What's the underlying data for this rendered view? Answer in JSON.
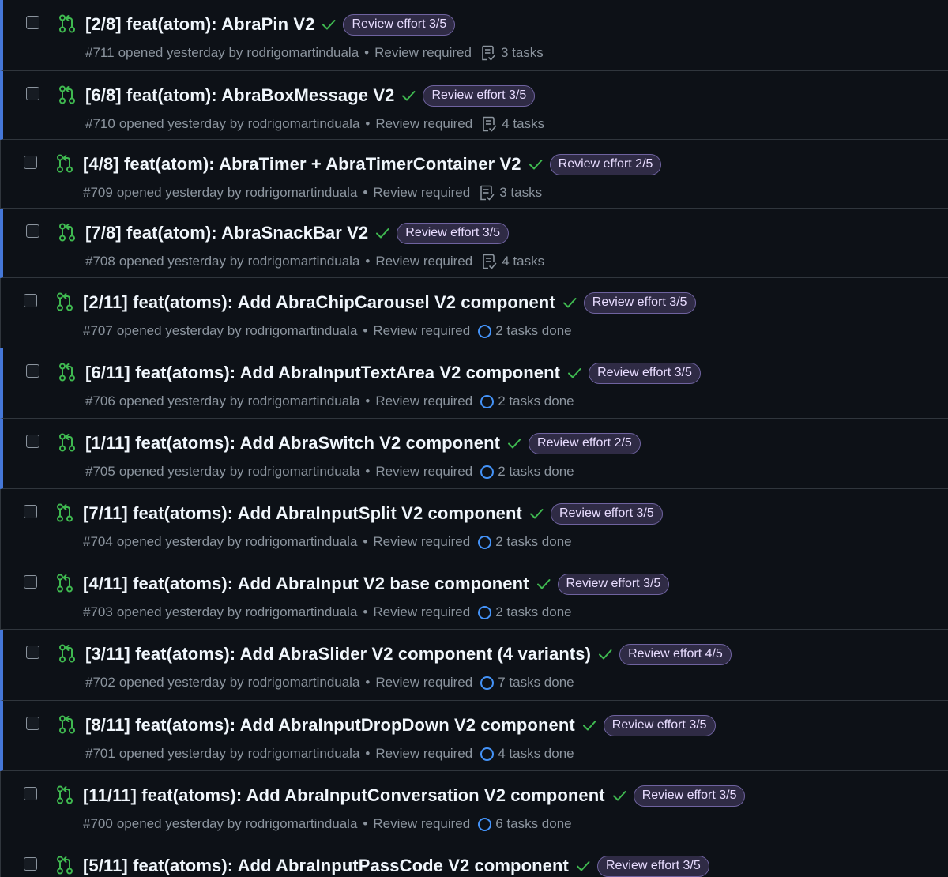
{
  "colors": {
    "background": "#0d1117",
    "border": "#30363d",
    "unread_accent": "#4577d8",
    "open_pr_icon": "#3fb950",
    "check_success": "#3fb950",
    "label_text": "#e8dcff",
    "label_bg": "#2f2b45",
    "muted_text": "#8b949e",
    "progress_ring": "#4493f8"
  },
  "meta": {
    "opened_text": "opened yesterday by",
    "separator": "•"
  },
  "pull_requests": [
    {
      "number": "#711",
      "title": "[2/8] feat(atom): AbraPin V2",
      "label": "Review effort 3/5",
      "author": "rodrigomartinduala",
      "review": "Review required",
      "tasks": "3 tasks",
      "task_style": "list",
      "unread": true
    },
    {
      "number": "#710",
      "title": "[6/8] feat(atom): AbraBoxMessage V2",
      "label": "Review effort 3/5",
      "author": "rodrigomartinduala",
      "review": "Review required",
      "tasks": "4 tasks",
      "task_style": "list",
      "unread": true
    },
    {
      "number": "#709",
      "title": "[4/8] feat(atom): AbraTimer + AbraTimerContainer V2",
      "label": "Review effort 2/5",
      "author": "rodrigomartinduala",
      "review": "Review required",
      "tasks": "3 tasks",
      "task_style": "list",
      "unread": false
    },
    {
      "number": "#708",
      "title": "[7/8] feat(atom): AbraSnackBar V2",
      "label": "Review effort 3/5",
      "author": "rodrigomartinduala",
      "review": "Review required",
      "tasks": "4 tasks",
      "task_style": "list",
      "unread": true
    },
    {
      "number": "#707",
      "title": "[2/11] feat(atoms): Add AbraChipCarousel V2 component",
      "label": "Review effort 3/5",
      "author": "rodrigomartinduala",
      "review": "Review required",
      "tasks": "2 tasks done",
      "task_style": "progress",
      "unread": false
    },
    {
      "number": "#706",
      "title": "[6/11] feat(atoms): Add AbraInputTextArea V2 component",
      "label": "Review effort 3/5",
      "author": "rodrigomartinduala",
      "review": "Review required",
      "tasks": "2 tasks done",
      "task_style": "progress",
      "unread": true
    },
    {
      "number": "#705",
      "title": "[1/11] feat(atoms): Add AbraSwitch V2 component",
      "label": "Review effort 2/5",
      "author": "rodrigomartinduala",
      "review": "Review required",
      "tasks": "2 tasks done",
      "task_style": "progress",
      "unread": true
    },
    {
      "number": "#704",
      "title": "[7/11] feat(atoms): Add AbraInputSplit V2 component",
      "label": "Review effort 3/5",
      "author": "rodrigomartinduala",
      "review": "Review required",
      "tasks": "2 tasks done",
      "task_style": "progress",
      "unread": false
    },
    {
      "number": "#703",
      "title": "[4/11] feat(atoms): Add AbraInput V2 base component",
      "label": "Review effort 3/5",
      "author": "rodrigomartinduala",
      "review": "Review required",
      "tasks": "2 tasks done",
      "task_style": "progress",
      "unread": false
    },
    {
      "number": "#702",
      "title": "[3/11] feat(atoms): Add AbraSlider V2 component (4 variants)",
      "label": "Review effort 4/5",
      "author": "rodrigomartinduala",
      "review": "Review required",
      "tasks": "7 tasks done",
      "task_style": "progress",
      "unread": true
    },
    {
      "number": "#701",
      "title": "[8/11] feat(atoms): Add AbraInputDropDown V2 component",
      "label": "Review effort 3/5",
      "author": "rodrigomartinduala",
      "review": "Review required",
      "tasks": "4 tasks done",
      "task_style": "progress",
      "unread": true
    },
    {
      "number": "#700",
      "title": "[11/11] feat(atoms): Add AbraInputConversation V2 component",
      "label": "Review effort 3/5",
      "author": "rodrigomartinduala",
      "review": "Review required",
      "tasks": "6 tasks done",
      "task_style": "progress",
      "unread": false
    },
    {
      "number": "",
      "title": "[5/11] feat(atoms): Add AbraInputPassCode V2 component",
      "label": "Review effort 3/5",
      "author": "",
      "review": "",
      "tasks": "",
      "task_style": "none",
      "unread": false
    }
  ]
}
